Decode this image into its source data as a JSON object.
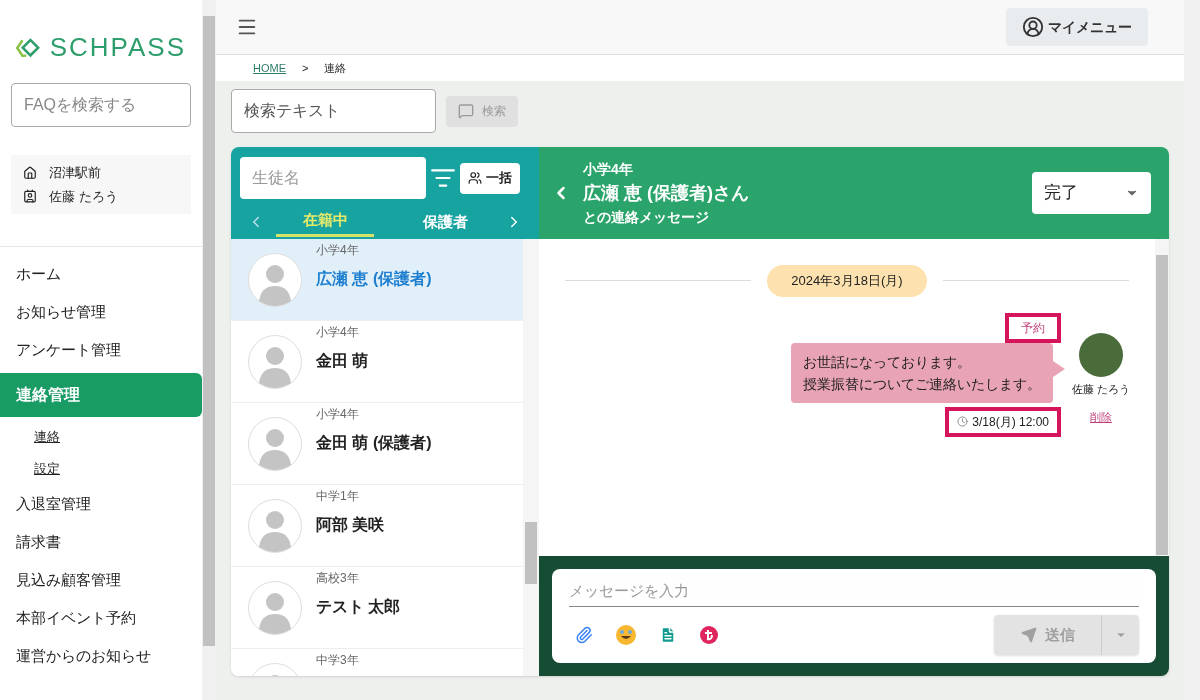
{
  "sidebar": {
    "logo": "SCHPASS",
    "faq_search": {
      "placeholder": "FAQを検索する"
    },
    "school": "沼津駅前",
    "user": "佐藤 たろう",
    "items": [
      {
        "label": "ホーム",
        "selected": false
      },
      {
        "label": "お知らせ管理",
        "selected": false
      },
      {
        "label": "アンケート管理",
        "selected": false
      },
      {
        "label": "連絡管理",
        "selected": true,
        "children": [
          {
            "label": "連絡"
          },
          {
            "label": "設定"
          }
        ]
      },
      {
        "label": "入退室管理",
        "selected": false
      },
      {
        "label": "請求書",
        "selected": false
      },
      {
        "label": "見込み顧客管理",
        "selected": false
      },
      {
        "label": "本部イベント予約",
        "selected": false
      },
      {
        "label": "運営からのお知らせ",
        "selected": false
      }
    ]
  },
  "header": {
    "my_menu": "マイメニュー"
  },
  "breadcrumb": [
    "HOME",
    ">",
    "連絡"
  ],
  "search": {
    "placeholder": "検索テキスト",
    "button": "検索",
    "disabled": true
  },
  "student_panel": {
    "search": {
      "placeholder": "生徒名"
    },
    "bulk_button": "一括",
    "tabs": [
      {
        "label": "在籍中",
        "selected": true
      },
      {
        "label": "保護者",
        "selected": false
      }
    ],
    "students": [
      {
        "grade": "小学4年",
        "name": "広瀬 恵 (保護者)",
        "selected": true
      },
      {
        "grade": "小学4年",
        "name": "金田 萌",
        "selected": false
      },
      {
        "grade": "小学4年",
        "name": "金田 萌 (保護者)",
        "selected": false
      },
      {
        "grade": "中学1年",
        "name": "阿部 美咲",
        "selected": false
      },
      {
        "grade": "高校3年",
        "name": "テスト 太郎",
        "selected": false
      },
      {
        "grade": "中学3年",
        "selected": false
      }
    ]
  },
  "chat": {
    "grade": "小学4年",
    "name": "広瀬 恵 (保護者)さん",
    "subtitle": "との連絡メッセージ",
    "status": "完了",
    "date": "2024年3月18日(月)",
    "messages": [
      {
        "tag": "予約",
        "lines": [
          "お世話になっております。",
          "授業振替についてご連絡いたします。"
        ],
        "sender": "佐藤 たろう",
        "time": "3/18(月) 12:00",
        "delete": "削除",
        "highlighted": true
      }
    ],
    "composer": {
      "placeholder": "メッセージを入力",
      "send": "送信",
      "disabled": true
    }
  }
}
